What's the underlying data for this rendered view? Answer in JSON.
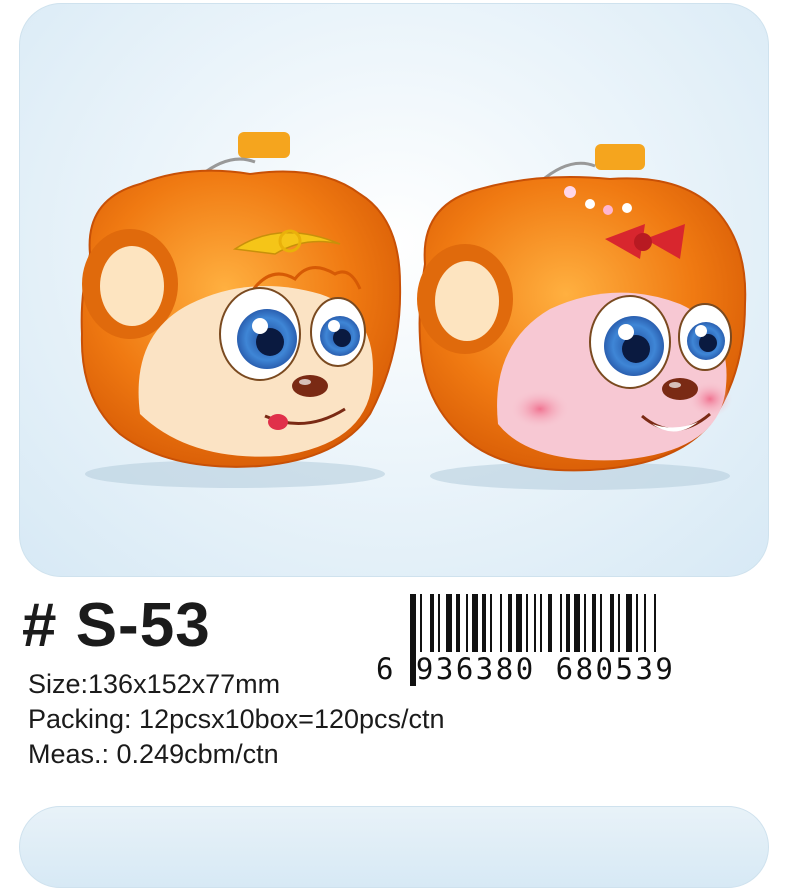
{
  "product": {
    "model_number": "# S-53",
    "size": "Size:136x152x77mm",
    "packing": "Packing: 12pcsx10box=120pcs/ctn",
    "measurement": "Meas.: 0.249cbm/ctn"
  },
  "barcode": {
    "digits": "6 936380 680539"
  },
  "colors": {
    "tin_orange": "#f07a12",
    "background_blue": "#d7e9f5",
    "girl_face_pink": "#f7c8d3",
    "boy_face_cream": "#fbe3c4",
    "bow_red": "#d8262e"
  }
}
